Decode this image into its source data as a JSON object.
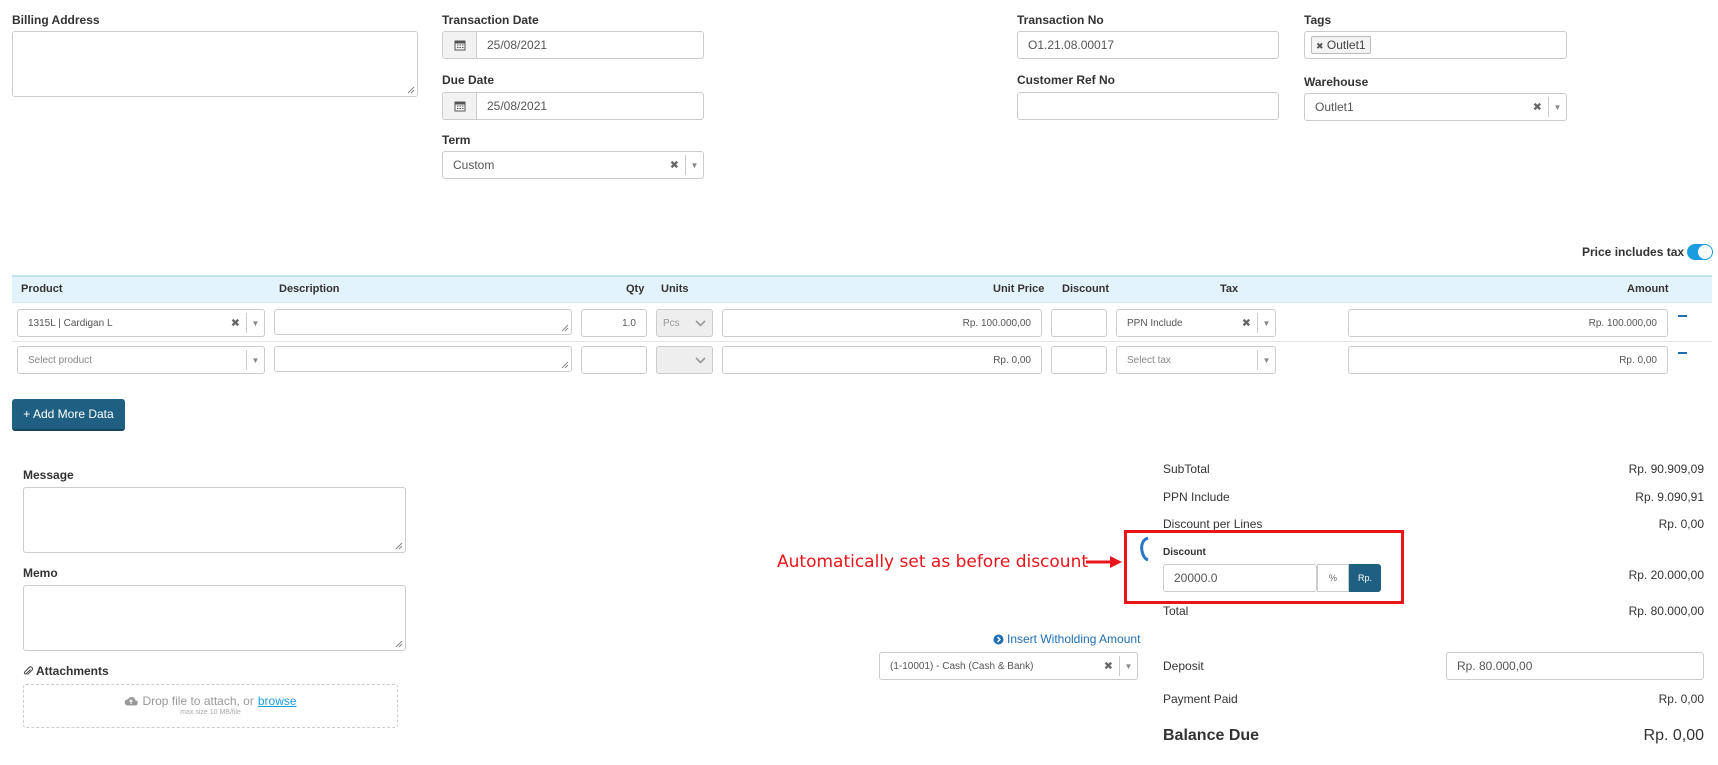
{
  "billing": {
    "label": "Billing Address"
  },
  "transaction_date": {
    "label": "Transaction Date",
    "value": "25/08/2021"
  },
  "due_date": {
    "label": "Due Date",
    "value": "25/08/2021"
  },
  "term": {
    "label": "Term",
    "value": "Custom"
  },
  "transaction_no": {
    "label": "Transaction No",
    "value": "O1.21.08.00017"
  },
  "customer_ref": {
    "label": "Customer Ref No",
    "value": ""
  },
  "tags": {
    "label": "Tags",
    "chip": "Outlet1"
  },
  "warehouse": {
    "label": "Warehouse",
    "value": "Outlet1"
  },
  "price_includes_tax": {
    "label": "Price includes tax",
    "on": true
  },
  "table": {
    "headers": {
      "product": "Product",
      "description": "Description",
      "qty": "Qty",
      "units": "Units",
      "unit_price": "Unit Price",
      "discount": "Discount",
      "tax": "Tax",
      "amount": "Amount"
    },
    "rows": [
      {
        "product": "1315L | Cardigan L",
        "description": "",
        "qty": "1.0",
        "unit": "Pcs",
        "unit_price": "Rp. 100.000,00",
        "discount": "",
        "tax": "PPN Include",
        "amount": "Rp. 100.000,00"
      },
      {
        "product_placeholder": "Select product",
        "description": "",
        "qty": "",
        "unit": "",
        "unit_price": "Rp. 0,00",
        "discount": "",
        "tax_placeholder": "Select tax",
        "amount": "Rp. 0,00"
      }
    ]
  },
  "add_more_label": "+ Add More Data",
  "message": {
    "label": "Message"
  },
  "memo": {
    "label": "Memo"
  },
  "attachments": {
    "label": "Attachments",
    "drop_text": "Drop file to attach, or",
    "browse": "browse",
    "max_size": "max size 10 MB/file"
  },
  "withholding": {
    "link": "Insert Witholding Amount",
    "account": "(1-10001) - Cash (Cash & Bank)"
  },
  "summary": {
    "subtotal_label": "SubTotal",
    "subtotal": "Rp. 90.909,09",
    "ppn_label": "PPN Include",
    "ppn": "Rp. 9.090,91",
    "discount_lines_label": "Discount per Lines",
    "discount_lines": "Rp. 0,00",
    "discount_label": "Discount",
    "discount_input": "20000.0",
    "discount_pct_btn": "%",
    "discount_rp_btn": "Rp.",
    "discount_amount": "Rp. 20.000,00",
    "total_label": "Total",
    "total": "Rp. 80.000,00",
    "deposit_label": "Deposit",
    "deposit": "Rp. 80.000,00",
    "payment_paid_label": "Payment Paid",
    "payment_paid": "Rp. 0,00",
    "balance_due_label": "Balance Due",
    "balance_due": "Rp. 0,00"
  },
  "annotation": {
    "text": "Automatically set as before discount",
    "color": "#e8151b"
  },
  "colors": {
    "accent": "#1f5f82",
    "link": "#1f6fb2",
    "table_header_bg": "#e3f3fb",
    "toggle": "#1a9de0"
  }
}
